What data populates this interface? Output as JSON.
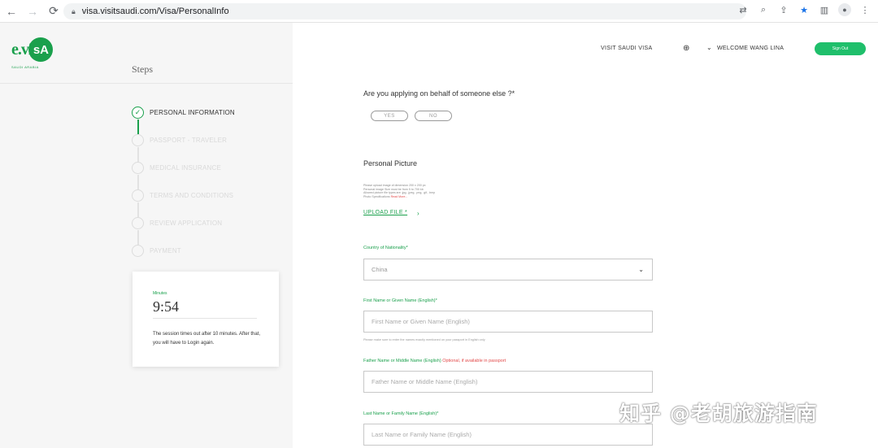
{
  "browser": {
    "url": "visa.visitsaudi.com/Visa/PersonalInfo"
  },
  "sidebar": {
    "logo_text": "e.vi",
    "logo_badge": "sA",
    "logo_sub": "SAUDI ARABIA",
    "steps_title": "Steps",
    "steps": [
      {
        "label": "PERSONAL INFORMATION",
        "active": true
      },
      {
        "label": "PASSPORT - TRAVELER",
        "active": false
      },
      {
        "label": "MEDICAL INSURANCE",
        "active": false
      },
      {
        "label": "TERMS AND CONDITIONS",
        "active": false
      },
      {
        "label": "REVIEW APPLICATION",
        "active": false
      },
      {
        "label": "PAYMENT",
        "active": false
      }
    ],
    "timer": {
      "label": "Minutes",
      "value": "9:54",
      "message": "The session times out after 10 minutes. After that, you will have to Login again."
    }
  },
  "topnav": {
    "visit": "VISIT SAUDI VISA",
    "welcome": "WELCOME WANG LINA",
    "signout": "Sign Out"
  },
  "form": {
    "behalf_question": "Are you applying on behalf of someone else ?*",
    "yes": "YES",
    "no": "NO",
    "picture_title": "Personal Picture",
    "picture_info": [
      "Please upload image of dimension 200 x 200 px",
      "Personal image Size must be from 5 to 700 kb",
      "Allowed picture file types are .jpg, .jpeg, .png, .gif, .bmp",
      "Photo Specifications"
    ],
    "read_more": "Read More...",
    "upload": "UPLOAD FILE *",
    "nationality_label": "Country of Nationality*",
    "nationality_value": "China",
    "first_name_label": "First Name or Given Name (English)*",
    "first_name_placeholder": "First Name or Given Name (English)",
    "first_name_hint": "Please make sure to enter the names exactly mentioned on your passport in English only",
    "father_name_label": "Father Name or Middle Name (English)",
    "father_name_optional": "Optional, if available in passport",
    "father_name_placeholder": "Father Name or Middle Name (English)",
    "last_name_label": "Last Name or Family Name (English)*",
    "last_name_placeholder": "Last Name or Family Name (English)"
  },
  "watermark": "知乎 @老胡旅游指南",
  "colors": {
    "accent": "#1aa04c",
    "button": "#1fbf6b",
    "optional": "#e24a4a"
  }
}
